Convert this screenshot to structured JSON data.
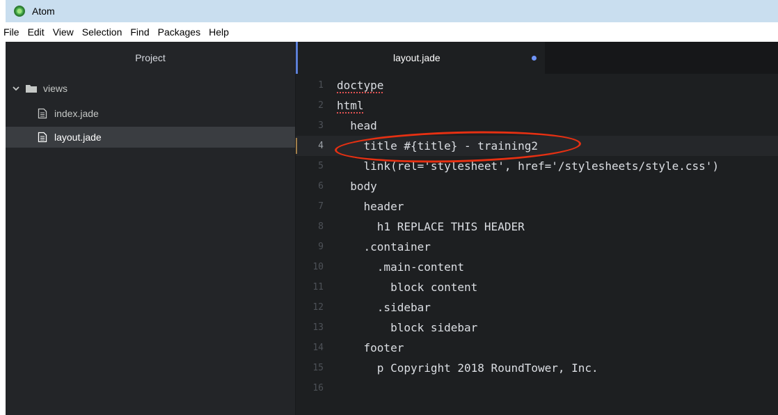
{
  "window": {
    "title": "Atom"
  },
  "menu": [
    "File",
    "Edit",
    "View",
    "Selection",
    "Find",
    "Packages",
    "Help"
  ],
  "tree": {
    "header": "Project",
    "folder": "views",
    "files": [
      "index.jade",
      "layout.jade"
    ],
    "selected_file": "layout.jade"
  },
  "editor": {
    "tab_label": "layout.jade",
    "modified": true,
    "current_line": 4,
    "lines": [
      {
        "n": "1",
        "text": "doctype"
      },
      {
        "n": "2",
        "text": "html"
      },
      {
        "n": "3",
        "text": "  head"
      },
      {
        "n": "4",
        "text": "    title #{title} - training2"
      },
      {
        "n": "5",
        "text": "    link(rel='stylesheet', href='/stylesheets/style.css')"
      },
      {
        "n": "6",
        "text": "  body"
      },
      {
        "n": "7",
        "text": "    header"
      },
      {
        "n": "8",
        "text": "      h1 REPLACE THIS HEADER"
      },
      {
        "n": "9",
        "text": "    .container"
      },
      {
        "n": "10",
        "text": "      .main-content"
      },
      {
        "n": "11",
        "text": "        block content"
      },
      {
        "n": "12",
        "text": "      .sidebar"
      },
      {
        "n": "13",
        "text": "        block sidebar"
      },
      {
        "n": "14",
        "text": "    footer"
      },
      {
        "n": "15",
        "text": "      p Copyright 2018 RoundTower, Inc."
      },
      {
        "n": "16",
        "text": ""
      }
    ]
  },
  "colors": {
    "annotation": "#e63012",
    "tab_accent": "#5c7fd6",
    "modified_dot": "#6f94f7"
  }
}
